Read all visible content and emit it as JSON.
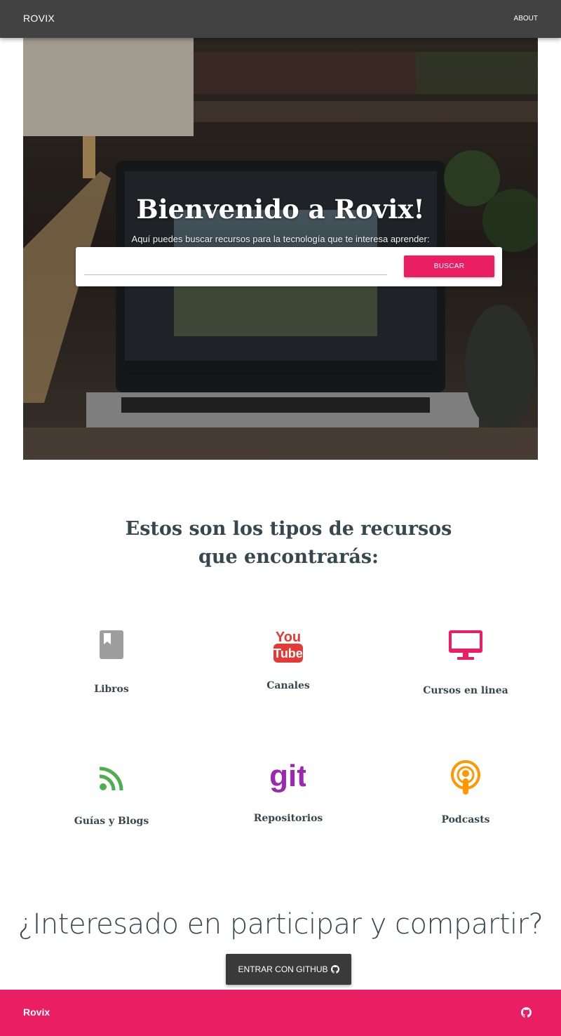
{
  "navbar": {
    "brand": "ROVIX",
    "about": "ABOUT"
  },
  "hero": {
    "title": "Bienvenido a Rovix!",
    "subtitle": "Aquí puedes buscar recursos para la tecnología que te interesa aprender:",
    "search": {
      "value": "",
      "placeholder": "",
      "button": "BUSCAR"
    }
  },
  "types": {
    "title": "Estos son los tipos de recursos que encontrarás:",
    "items": [
      {
        "label": "Libros",
        "icon": "book-icon",
        "color": "#9e9e9e"
      },
      {
        "label": "Canales",
        "icon": "youtube-icon",
        "color": "#e53935"
      },
      {
        "label": "Cursos en linea",
        "icon": "desktop-icon",
        "color": "#e91e63"
      },
      {
        "label": "Guías y Blogs",
        "icon": "rss-icon",
        "color": "#4caf50"
      },
      {
        "label": "Repositorios",
        "icon": "git-icon",
        "color": "#9c27b0"
      },
      {
        "label": "Podcasts",
        "icon": "podcast-icon",
        "color": "#ff9800"
      }
    ]
  },
  "cta": {
    "title": "¿Interesado en participar y compartir?",
    "button": "ENTRAR CON GITHUB"
  },
  "footer": {
    "brand": "Rovix",
    "icon": "github-icon"
  },
  "colors": {
    "navbar": "#424242",
    "accent": "#e91e63",
    "text": "#37474f",
    "button_dark": "#3a3a3a"
  }
}
